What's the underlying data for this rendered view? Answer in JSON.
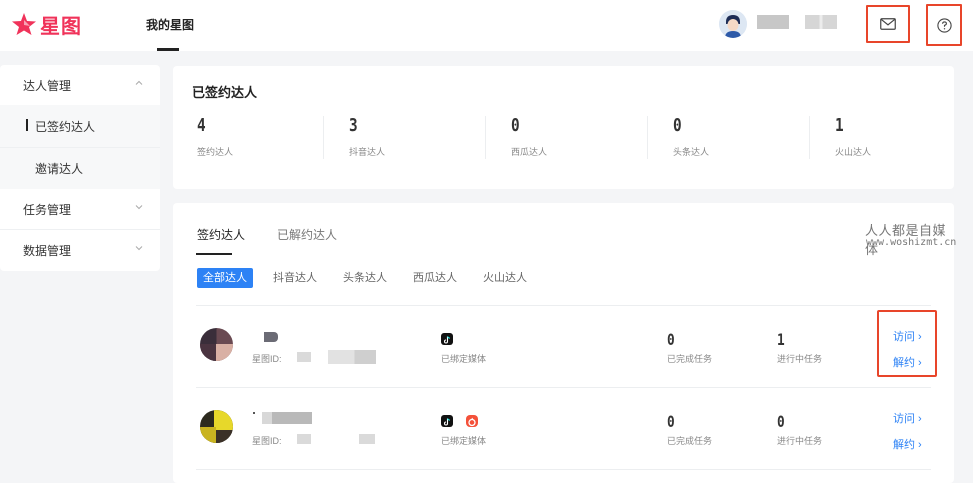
{
  "header": {
    "logo_text": "星图",
    "nav_mine": "我的星图"
  },
  "sidebar": {
    "items": [
      {
        "label": "达人管理"
      },
      {
        "label": "已签约达人"
      },
      {
        "label": "邀请达人"
      },
      {
        "label": "任务管理"
      },
      {
        "label": "数据管理"
      }
    ]
  },
  "summary": {
    "title": "已签约达人",
    "stats": [
      {
        "value": "4",
        "label": "签约达人"
      },
      {
        "value": "3",
        "label": "抖音达人"
      },
      {
        "value": "0",
        "label": "西瓜达人"
      },
      {
        "value": "0",
        "label": "头条达人"
      },
      {
        "value": "1",
        "label": "火山达人"
      }
    ]
  },
  "tabs": [
    {
      "label": "签约达人"
    },
    {
      "label": "已解约达人"
    }
  ],
  "watermark": {
    "title": "人人都是自媒体",
    "url": "www.woshizmt.cn"
  },
  "filters": [
    {
      "label": "全部达人"
    },
    {
      "label": "抖音达人"
    },
    {
      "label": "头条达人"
    },
    {
      "label": "西瓜达人"
    },
    {
      "label": "火山达人"
    }
  ],
  "rows": [
    {
      "id_label": "星图ID:",
      "media_label": "已绑定媒体",
      "done_count": "0",
      "done_label": "已完成任务",
      "ongoing_count": "1",
      "ongoing_label": "进行中任务",
      "visit": "访问 ›",
      "terminate": "解约 ›"
    },
    {
      "id_label": "星图ID:",
      "media_label": "已绑定媒体",
      "done_count": "0",
      "done_label": "已完成任务",
      "ongoing_count": "0",
      "ongoing_label": "进行中任务",
      "visit": "访问 ›",
      "terminate": "解约 ›"
    }
  ],
  "colors": {
    "brand": "#f0335a",
    "accent": "#2d82f5",
    "highlight_box": "#e8452a"
  }
}
